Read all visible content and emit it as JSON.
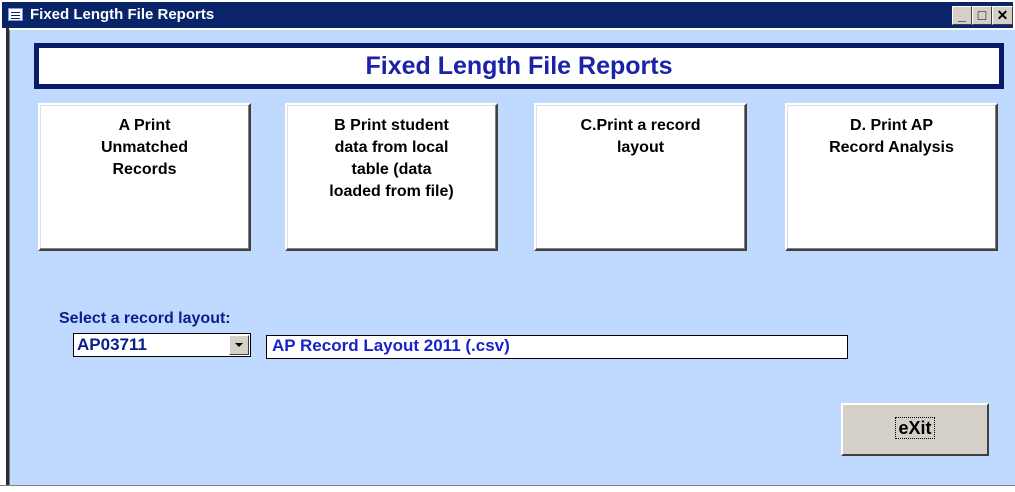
{
  "window": {
    "title": "Fixed Length File Reports",
    "buttons": {
      "minimize": "_",
      "maximize": "□",
      "close": "✕"
    }
  },
  "banner": {
    "title": "Fixed Length File Reports"
  },
  "report_buttons": [
    {
      "lines": [
        "A Print",
        "Unmatched",
        "Records"
      ]
    },
    {
      "lines": [
        "B Print student",
        "data from local",
        "table (data",
        "loaded from file)"
      ]
    },
    {
      "lines": [
        "C.Print a record",
        "layout"
      ]
    },
    {
      "lines": [
        "D. Print AP",
        "Record Analysis"
      ]
    }
  ],
  "record_layout": {
    "label": "Select a record layout:",
    "selected_code": "AP03711",
    "description": "AP Record Layout 2011 (.csv)"
  },
  "exit_button": {
    "label": "eXit"
  },
  "colors": {
    "titlebar": "#0a246a",
    "client_bg": "#c0d9ff",
    "banner_border": "#0a1a6b",
    "accent_text": "#1a23a5"
  }
}
